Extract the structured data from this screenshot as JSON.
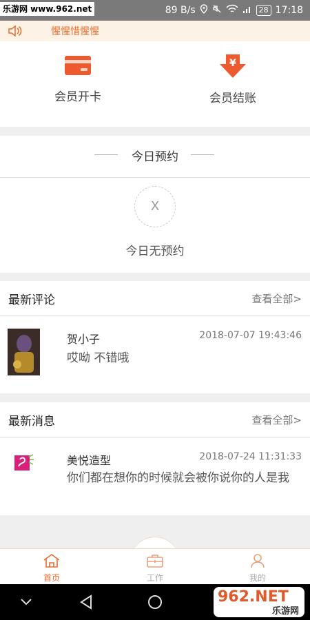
{
  "status_bar": {
    "watermark": "乐游网 www.962.net",
    "speed": "89 B/s",
    "battery": "28",
    "time": "17:18"
  },
  "notice": {
    "text": "惺惺惜惺惺"
  },
  "actions": [
    {
      "label": "会员开卡",
      "icon": "card-icon"
    },
    {
      "label": "会员结账",
      "icon": "yen-arrow-icon"
    }
  ],
  "today": {
    "title": "今日预约",
    "empty_mark": "X",
    "empty_text": "今日无预约"
  },
  "reviews": {
    "title": "最新评论",
    "more": "查看全部>",
    "items": [
      {
        "name": "贺小子",
        "time": "2018-07-07 19:43:46",
        "text": "哎呦 不错哦"
      }
    ]
  },
  "messages": {
    "title": "最新消息",
    "more": "查看全部>",
    "items": [
      {
        "name": "美悦造型",
        "time": "2018-07-24 11:31:33",
        "text": "你们都在想你的时候就会被你说你的人是我"
      }
    ]
  },
  "tabs": [
    {
      "label": "首页",
      "icon": "home-icon",
      "active": true
    },
    {
      "label": "工作",
      "icon": "briefcase-icon",
      "active": false
    },
    {
      "label": "我的",
      "icon": "user-icon",
      "active": false
    }
  ],
  "bottom_watermark": {
    "big": "962.NET",
    "small": "乐游网"
  },
  "colors": {
    "accent": "#e96d2d",
    "notice_bg": "#fdf2e6"
  }
}
